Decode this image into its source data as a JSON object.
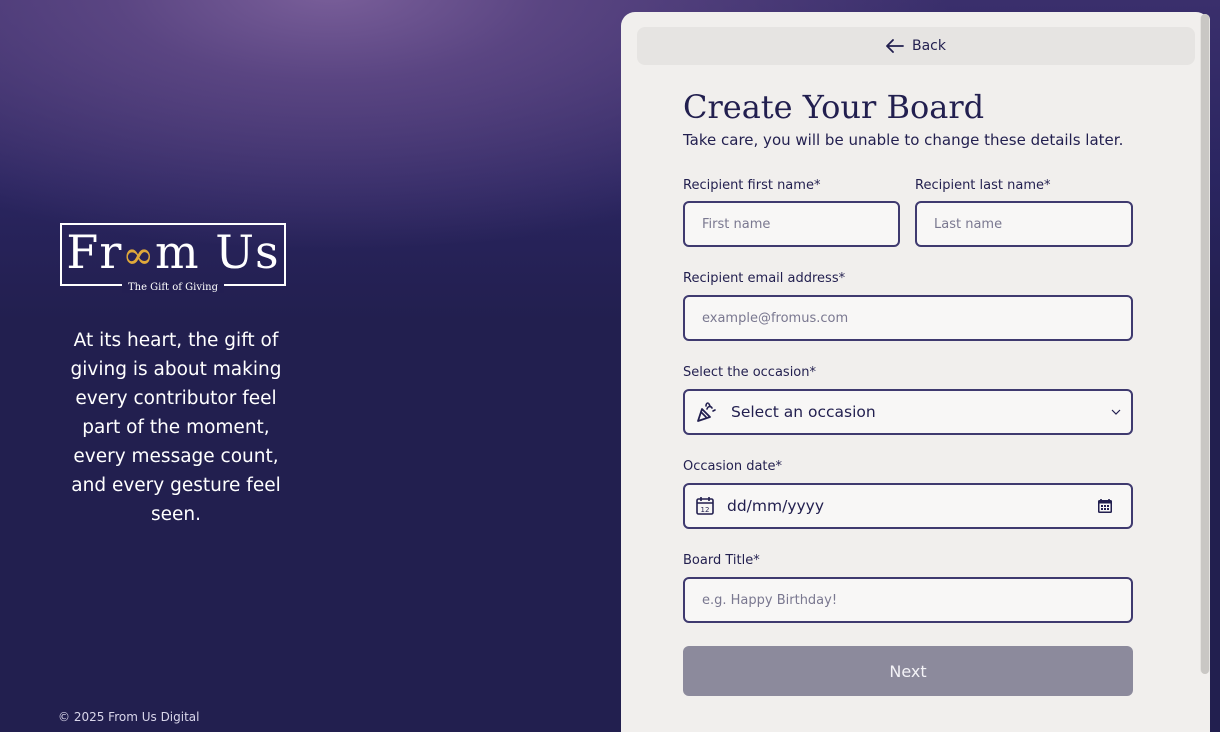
{
  "brand": {
    "logo_text": "Fr∞m Us",
    "logo_subtitle": "The Gift of Giving",
    "tagline": "At its heart, the gift of giving is about making every contributor feel part of the moment, every message count, and every gesture feel seen.",
    "copyright": "© 2025 From Us Digital"
  },
  "panel": {
    "back_label": "Back",
    "title": "Create Your Board",
    "subtitle": "Take care, you will be unable to change these details later."
  },
  "form": {
    "first_name": {
      "label": "Recipient first name*",
      "placeholder": "First name",
      "value": ""
    },
    "last_name": {
      "label": "Recipient last name*",
      "placeholder": "Last name",
      "value": ""
    },
    "email": {
      "label": "Recipient email address*",
      "placeholder": "example@fromus.com",
      "value": ""
    },
    "occasion": {
      "label": "Select the occasion*",
      "value": "Select an occasion",
      "icon": "party-popper-icon"
    },
    "date": {
      "label": "Occasion date*",
      "value": "dd/mm/yyyy",
      "icon": "calendar-icon"
    },
    "board_title": {
      "label": "Board Title*",
      "placeholder": "e.g. Happy Birthday!",
      "value": ""
    },
    "next_label": "Next"
  },
  "colors": {
    "navy": "#221f4f",
    "panel_bg": "#f1efed",
    "button_disabled": "#8c8a9c",
    "accent_gold": "#e0a93a"
  }
}
